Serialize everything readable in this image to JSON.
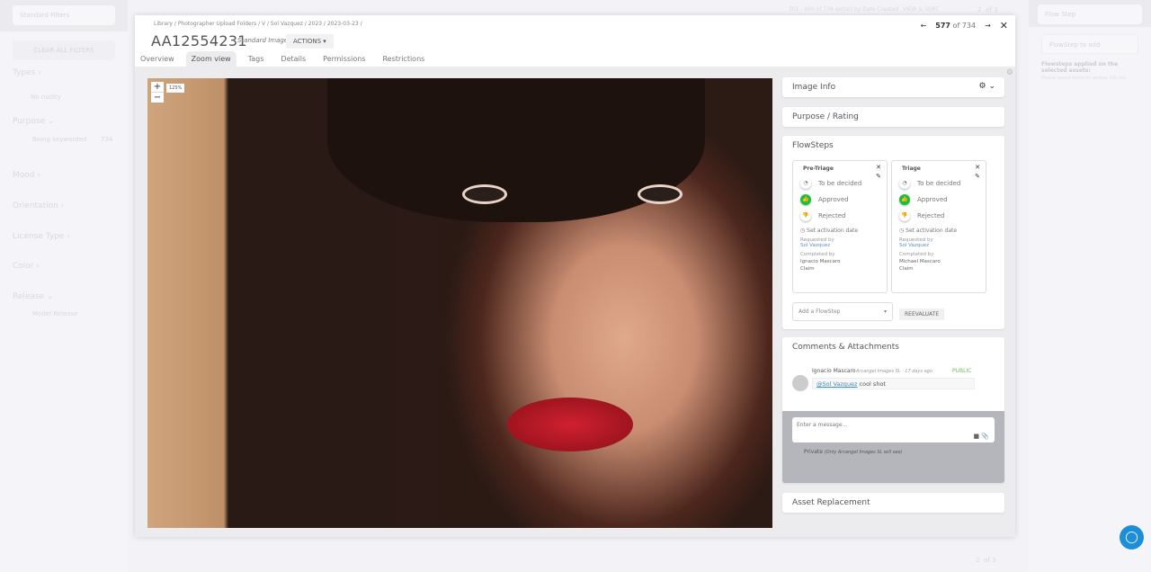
{
  "left_panel": {
    "filter_select": "Standard Filters",
    "clear_all": "CLEAR ALL FILTERS",
    "sections": [
      {
        "label": "Types ›"
      },
      {
        "label": "Purpose ⌄"
      },
      {
        "label": "Mood ›"
      },
      {
        "label": "Orientation ›"
      },
      {
        "label": "License Type ›"
      },
      {
        "label": "Color ›"
      },
      {
        "label": "Release ⌄"
      }
    ],
    "no_nudity": "No nudity",
    "being_keyworded": "Being keyworded",
    "being_keyworded_count": "734",
    "model_release": "Model Release"
  },
  "top_bar": {
    "results": "301 - 600 of 734 sorted by Date Created",
    "view_sort": "VIEW & SORT",
    "page": "2",
    "of_pages": "of 3"
  },
  "right_panel": {
    "flow_step": "Flow Step",
    "flowstep_to_add": "FlowStep to add",
    "applied_title": "Flowsteps applied on the selected assets:",
    "applied_hint": "Please select items to update this list."
  },
  "modal": {
    "breadcrumb": "Library  /  Photographer Upload Folders  /  V  /  Sol Vazquez  /  2023  /  2023-03-23  /",
    "title": "AA12554231",
    "type": "Standard Image",
    "actions": "ACTIONS ▾",
    "tabs": [
      "Overview",
      "Zoom view",
      "Tags",
      "Details",
      "Permissions",
      "Restrictions"
    ],
    "position": "577",
    "total": "of 734",
    "zoom_level": "125%",
    "panels": {
      "image_info": "Image Info",
      "purpose": "Purpose / Rating",
      "flowsteps": "FlowSteps",
      "comments": "Comments & Attachments",
      "asset_replacement": "Asset Replacement"
    },
    "flowsteps": [
      {
        "name": "Pre-Triage",
        "states": [
          "To be decided",
          "Approved",
          "Rejected"
        ],
        "activation": "Set activation date",
        "requested_label": "Requested by",
        "requested_by": "Sol Vazquez",
        "completed_label": "Completed by",
        "completed_by": "Ignacio Mascaro",
        "claim": "Claim"
      },
      {
        "name": "Triage",
        "states": [
          "To be decided",
          "Approved",
          "Rejected"
        ],
        "activation": "Set activation date",
        "requested_label": "Requested by",
        "requested_by": "Sol Vazquez",
        "completed_label": "Completed by",
        "completed_by": "Michael Mascaro",
        "claim": "Claim"
      }
    ],
    "add_flowstep": "Add a FlowStep",
    "reevaluate": "REEVALUATE",
    "comment": {
      "author": "Ignacio Mascaro",
      "meta": "Arcangel Images SL · 17 days ago",
      "visibility": "PUBLIC",
      "mention": "@Sol Vazquez",
      "text": " cool shot"
    },
    "message_placeholder": "Enter a message...",
    "private_label": "Private",
    "private_note": "(Only Arcangel Images SL will see)"
  },
  "bottom": {
    "page": "2",
    "of_pages": "of 3"
  }
}
